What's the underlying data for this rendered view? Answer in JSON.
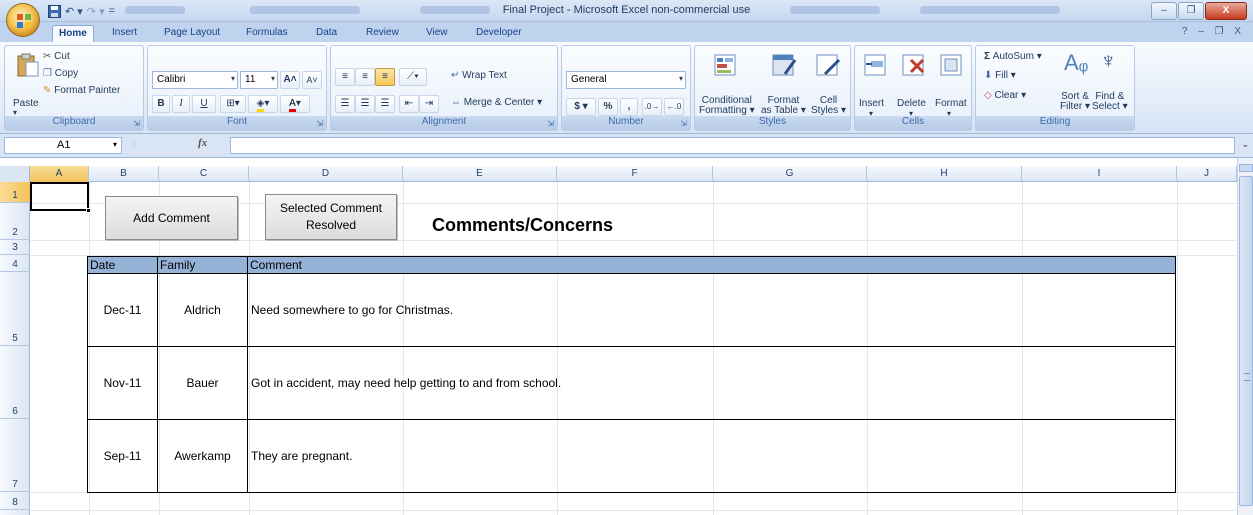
{
  "window": {
    "title": "Final Project - Microsoft Excel non-commercial use",
    "minimize_glyph": "–",
    "restore_glyph": "❐",
    "close_glyph": "X"
  },
  "qat": {
    "save_icon": "save-icon",
    "undo_glyph": "↶ ▾",
    "redo_glyph": "↷ ▾",
    "customize_glyph": "="
  },
  "tabs": [
    {
      "label": "Home",
      "active": true
    },
    {
      "label": "Insert"
    },
    {
      "label": "Page Layout"
    },
    {
      "label": "Formulas"
    },
    {
      "label": "Data"
    },
    {
      "label": "Review"
    },
    {
      "label": "View"
    },
    {
      "label": "Developer"
    }
  ],
  "ribbon_controls": "? – ❐ X",
  "clipboard": {
    "label": "Clipboard",
    "paste": "Paste",
    "cut": "Cut",
    "copy": "Copy",
    "format_painter": "Format Painter"
  },
  "font": {
    "label": "Font",
    "family": "Calibri",
    "size": "11",
    "bold": "B",
    "italic": "I",
    "underline": "U"
  },
  "alignment": {
    "label": "Alignment",
    "wrap_text": "Wrap Text",
    "merge_center": "Merge & Center"
  },
  "number": {
    "label": "Number",
    "format": "General",
    "currency": "$",
    "percent": "%",
    "comma": ","
  },
  "styles": {
    "label": "Styles",
    "conditional": "Conditional",
    "conditional2": "Formatting",
    "format_as": "Format",
    "format_as2": "as Table",
    "cell": "Cell",
    "cell2": "Styles"
  },
  "cells": {
    "label": "Cells",
    "insert": "Insert",
    "delete": "Delete",
    "format": "Format"
  },
  "editing": {
    "label": "Editing",
    "autosum": "AutoSum",
    "fill": "Fill",
    "clear": "Clear",
    "sort": "Sort &",
    "sort2": "Filter",
    "find": "Find &",
    "find2": "Select"
  },
  "formula_bar": {
    "name_box": "A1",
    "fx": "fx",
    "formula": ""
  },
  "columns": [
    "A",
    "B",
    "C",
    "D",
    "E",
    "F",
    "G",
    "H",
    "I",
    "J"
  ],
  "rows": [
    "1",
    "2",
    "3",
    "4",
    "5",
    "6",
    "7",
    "8"
  ],
  "sheet": {
    "add_comment_button": "Add Comment",
    "resolved_button_line1": "Selected Comment",
    "resolved_button_line2": "Resolved",
    "title": "Comments/Concerns",
    "table_headers": [
      "Date",
      "Family",
      "Comment"
    ],
    "table_rows": [
      {
        "date": "Dec-11",
        "family": "Aldrich",
        "comment": "Need somewhere to go for Christmas."
      },
      {
        "date": "Nov-11",
        "family": "Bauer",
        "comment": "Got in accident, may need help getting to and from school."
      },
      {
        "date": "Sep-11",
        "family": "Awerkamp",
        "comment": "They are pregnant."
      }
    ]
  },
  "colors": {
    "header_fill": "#95b3d7",
    "ribbon_bg": "#dfe9f5",
    "selected_header": "#f5c96b"
  }
}
